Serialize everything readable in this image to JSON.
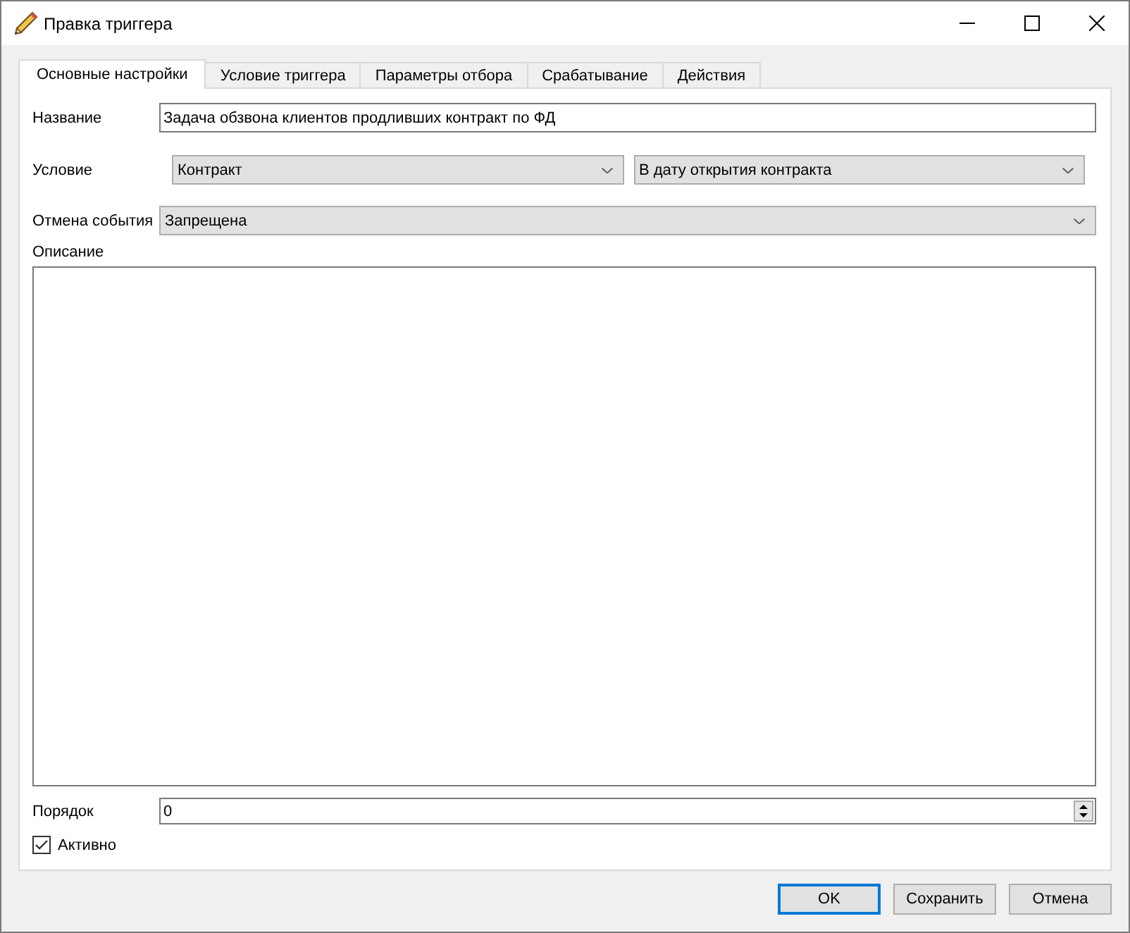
{
  "window": {
    "title": "Правка триггера"
  },
  "tabs": [
    {
      "label": "Основные настройки",
      "selected": true
    },
    {
      "label": "Условие триггера",
      "selected": false
    },
    {
      "label": "Параметры отбора",
      "selected": false
    },
    {
      "label": "Срабатывание",
      "selected": false
    },
    {
      "label": "Действия",
      "selected": false
    }
  ],
  "form": {
    "name": {
      "label": "Название",
      "value": "Задача обзвона клиентов продливших контракт по ФД"
    },
    "condition": {
      "label": "Условие",
      "dropdowns": [
        {
          "value": "Контракт"
        },
        {
          "value": "В дату открытия контракта"
        }
      ]
    },
    "cancel_event": {
      "label": "Отмена события",
      "value": "Запрещена"
    },
    "description": {
      "label": "Описание"
    },
    "order": {
      "label": "Порядок",
      "value": "0"
    },
    "active": {
      "label": "Активно",
      "checked": true
    }
  },
  "buttons": [
    {
      "label": "OK",
      "focused": true
    },
    {
      "label": "Сохранить",
      "focused": false
    },
    {
      "label": "Отмена",
      "focused": false
    }
  ]
}
